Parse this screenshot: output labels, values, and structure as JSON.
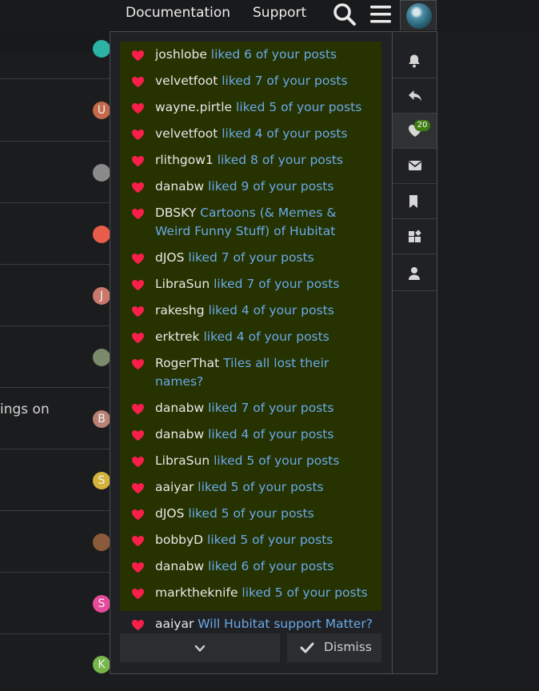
{
  "header": {
    "documentation_label": "Documentation",
    "support_label": "Support"
  },
  "background": {
    "partial_text": "ings on",
    "avatars": [
      {
        "letter": "",
        "color": "#2bb3a6"
      },
      {
        "letter": "U",
        "color": "#c46a4a"
      },
      {
        "letter": "",
        "color": "#8a8a8a"
      },
      {
        "letter": "",
        "color": "#e85c4a"
      },
      {
        "letter": "J",
        "color": "#c9786b"
      },
      {
        "letter": "",
        "color": "#7a8a6a"
      },
      {
        "letter": "B",
        "color": "#b78275"
      },
      {
        "letter": "S",
        "color": "#d4b33c"
      },
      {
        "letter": "",
        "color": "#8a5a3a"
      },
      {
        "letter": "S",
        "color": "#e64a9b"
      },
      {
        "letter": "K",
        "color": "#76b64a"
      }
    ]
  },
  "notifications": [
    {
      "user": "joshlobe",
      "desc": "liked 6 of your posts",
      "unread": true
    },
    {
      "user": "velvetfoot",
      "desc": "liked 7 of your posts",
      "unread": true
    },
    {
      "user": "wayne.pirtle",
      "desc": "liked 5 of your posts",
      "unread": true
    },
    {
      "user": "velvetfoot",
      "desc": "liked 4 of your posts",
      "unread": true
    },
    {
      "user": "rlithgow1",
      "desc": "liked 8 of your posts",
      "unread": true
    },
    {
      "user": "danabw",
      "desc": "liked 9 of your posts",
      "unread": true
    },
    {
      "user": "DBSKY",
      "desc": "Cartoons (& Memes & Weird Funny Stuff) of Hubitat",
      "unread": true
    },
    {
      "user": "dJOS",
      "desc": "liked 7 of your posts",
      "unread": true
    },
    {
      "user": "LibraSun",
      "desc": "liked 7 of your posts",
      "unread": true
    },
    {
      "user": "rakeshg",
      "desc": "liked 4 of your posts",
      "unread": true
    },
    {
      "user": "erktrek",
      "desc": "liked 4 of your posts",
      "unread": true
    },
    {
      "user": "RogerThat",
      "desc": "Tiles all lost their names?",
      "unread": true
    },
    {
      "user": "danabw",
      "desc": "liked 7 of your posts",
      "unread": true
    },
    {
      "user": "danabw",
      "desc": "liked 4 of your posts",
      "unread": true
    },
    {
      "user": "LibraSun",
      "desc": "liked 5 of your posts",
      "unread": true
    },
    {
      "user": "aaiyar",
      "desc": "liked 5 of your posts",
      "unread": true
    },
    {
      "user": "dJOS",
      "desc": "liked 5 of your posts",
      "unread": true
    },
    {
      "user": "bobbyD",
      "desc": "liked 5 of your posts",
      "unread": true
    },
    {
      "user": "danabw",
      "desc": "liked 6 of your posts",
      "unread": true
    },
    {
      "user": "marktheknife",
      "desc": "liked 5 of your posts",
      "unread": true
    },
    {
      "user": "aaiyar",
      "desc": "Will Hubitat support Matter? [Spoiler: YES]",
      "unread": false
    }
  ],
  "footer": {
    "dismiss_label": "Dismiss"
  },
  "tabs": {
    "likes_badge": "20",
    "items": [
      {
        "icon": "bell-icon",
        "active": false
      },
      {
        "icon": "reply-icon",
        "active": false
      },
      {
        "icon": "heart-icon",
        "active": true
      },
      {
        "icon": "envelope-icon",
        "active": false
      },
      {
        "icon": "bookmark-icon",
        "active": false
      },
      {
        "icon": "widgets-icon",
        "active": false
      },
      {
        "icon": "user-icon",
        "active": false
      }
    ]
  },
  "colors": {
    "unread_bg": "#263200",
    "link_blue": "#6aa9e8",
    "heart_red": "#fa1e4b",
    "badge_green": "#3e7d12"
  }
}
